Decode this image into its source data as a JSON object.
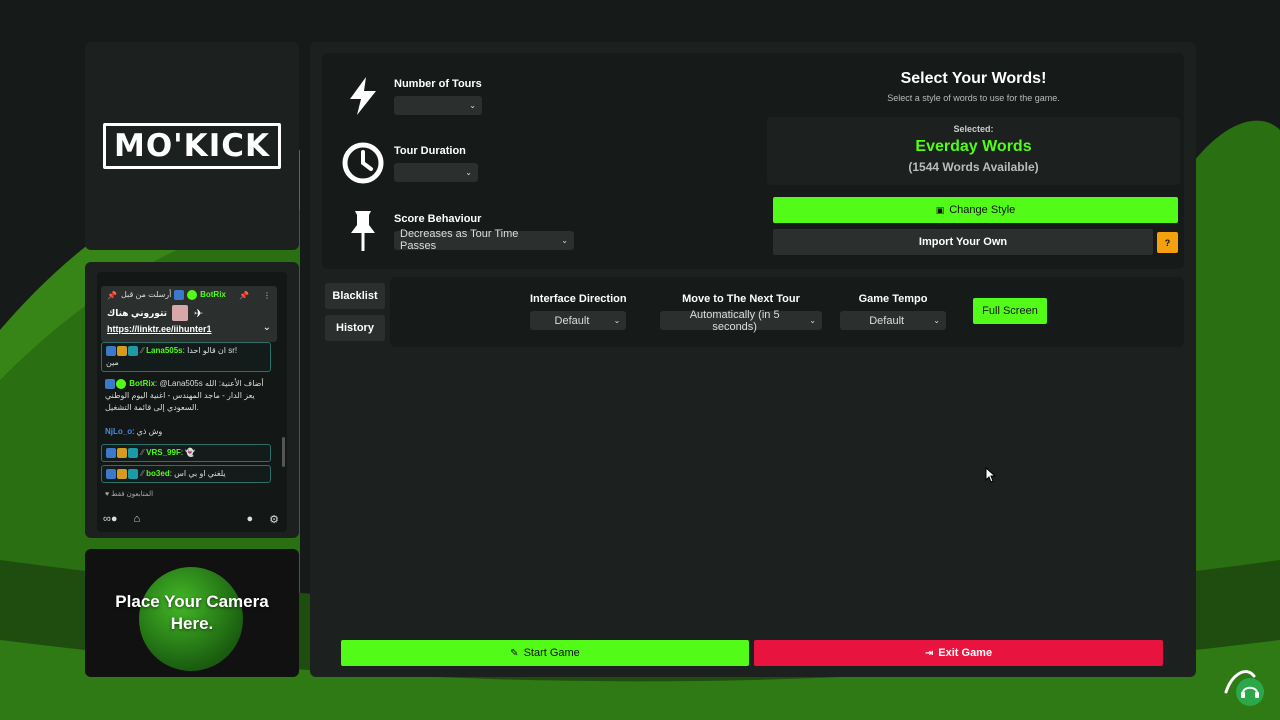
{
  "logo": {
    "text": "MO'KICK"
  },
  "chat": {
    "pinned": {
      "pinned_by": "أرسلت من قبل",
      "pinned_user": "BotRix",
      "title": "تتوروني هناك",
      "link": "https://linktr.ee/iihunter1"
    },
    "messages": [
      {
        "user": "Lana505s",
        "text": "ان قالو احدا sr!",
        "extra": "مين"
      },
      {
        "user": "BotRix",
        "text": "@Lana505s أضاف الأعنية: الله يعز الدار - ماجد المهندس - اغنية اليوم الوطني السعودي إلى قائمة التشغيل."
      },
      {
        "user": "NjLo_o",
        "text": "وش ذي"
      },
      {
        "user": "VRS_99F",
        "text": ""
      },
      {
        "user": "bo3ed",
        "text": "يلغني او بي اس"
      }
    ],
    "followers_only": "المتابعون فقط"
  },
  "camera": {
    "line1": "Place Your Camera",
    "line2": "Here."
  },
  "settings": {
    "tours": {
      "label": "Number of Tours",
      "value": ""
    },
    "duration": {
      "label": "Tour Duration",
      "value": ""
    },
    "score": {
      "label": "Score Behaviour",
      "value": "Decreases as Tour Time Passes"
    }
  },
  "words": {
    "title": "Select Your Words!",
    "subtitle": "Select a style of words to use for the game.",
    "selected_label": "Selected:",
    "selected_name": "Everday Words",
    "available": "(1544 Words Available)",
    "change_style": "Change Style",
    "import_own": "Import Your Own",
    "help": "?"
  },
  "tabs": {
    "blacklist": "Blacklist",
    "history": "History"
  },
  "options": {
    "direction": {
      "label": "Interface Direction",
      "value": "Default"
    },
    "next_tour": {
      "label": "Move to The Next Tour",
      "value": "Automatically (in 5 seconds)"
    },
    "tempo": {
      "label": "Game Tempo",
      "value": "Default"
    },
    "fullscreen": "Full Screen"
  },
  "actions": {
    "start": "Start Game",
    "exit": "Exit Game"
  },
  "colors": {
    "accent": "#53fc18",
    "danger": "#e8143f",
    "warning": "#f5a00f",
    "panel": "#1c2120"
  }
}
